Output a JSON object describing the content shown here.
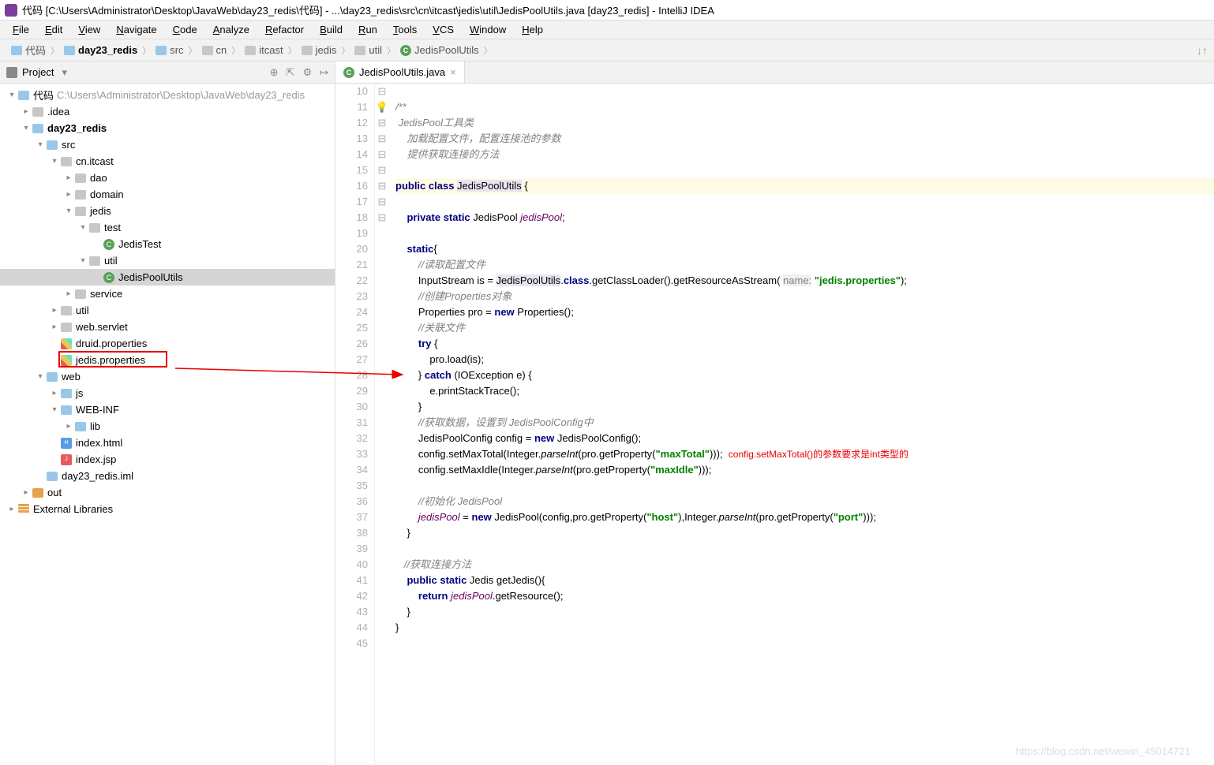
{
  "title": "代码 [C:\\Users\\Administrator\\Desktop\\JavaWeb\\day23_redis\\代码] - ...\\day23_redis\\src\\cn\\itcast\\jedis\\util\\JedisPoolUtils.java [day23_redis] - IntelliJ IDEA",
  "menu": [
    "File",
    "Edit",
    "View",
    "Navigate",
    "Code",
    "Analyze",
    "Refactor",
    "Build",
    "Run",
    "Tools",
    "VCS",
    "Window",
    "Help"
  ],
  "breadcrumbs": [
    {
      "label": "代码",
      "icon": "fld"
    },
    {
      "label": "day23_redis",
      "icon": "fld",
      "bold": true
    },
    {
      "label": "src",
      "icon": "fld"
    },
    {
      "label": "cn",
      "icon": "fld-gray"
    },
    {
      "label": "itcast",
      "icon": "fld-gray"
    },
    {
      "label": "jedis",
      "icon": "fld-gray"
    },
    {
      "label": "util",
      "icon": "fld-gray"
    },
    {
      "label": "JedisPoolUtils",
      "icon": "class"
    }
  ],
  "sidebar": {
    "title": "Project",
    "tree": [
      {
        "d": 0,
        "a": "v",
        "i": "fld",
        "l": "代码",
        "hint": "C:\\Users\\Administrator\\Desktop\\JavaWeb\\day23_redis"
      },
      {
        "d": 1,
        "a": ">",
        "i": "fld-gray",
        "l": ".idea"
      },
      {
        "d": 1,
        "a": "v",
        "i": "fld",
        "l": "day23_redis",
        "bold": true
      },
      {
        "d": 2,
        "a": "v",
        "i": "fld",
        "l": "src"
      },
      {
        "d": 3,
        "a": "v",
        "i": "fld-gray",
        "l": "cn.itcast"
      },
      {
        "d": 4,
        "a": ">",
        "i": "fld-gray",
        "l": "dao"
      },
      {
        "d": 4,
        "a": ">",
        "i": "fld-gray",
        "l": "domain"
      },
      {
        "d": 4,
        "a": "v",
        "i": "fld-gray",
        "l": "jedis"
      },
      {
        "d": 5,
        "a": "v",
        "i": "fld-gray",
        "l": "test"
      },
      {
        "d": 6,
        "a": "",
        "i": "class",
        "l": "JedisTest"
      },
      {
        "d": 5,
        "a": "v",
        "i": "fld-gray",
        "l": "util"
      },
      {
        "d": 6,
        "a": "",
        "i": "class",
        "l": "JedisPoolUtils",
        "sel": true
      },
      {
        "d": 4,
        "a": ">",
        "i": "fld-gray",
        "l": "service"
      },
      {
        "d": 3,
        "a": ">",
        "i": "fld-gray",
        "l": "util"
      },
      {
        "d": 3,
        "a": ">",
        "i": "fld-gray",
        "l": "web.servlet"
      },
      {
        "d": 3,
        "a": "",
        "i": "prop",
        "l": "druid.properties"
      },
      {
        "d": 3,
        "a": "",
        "i": "prop",
        "l": "jedis.properties",
        "boxed": true
      },
      {
        "d": 2,
        "a": "v",
        "i": "fld",
        "l": "web"
      },
      {
        "d": 3,
        "a": ">",
        "i": "fld",
        "l": "js"
      },
      {
        "d": 3,
        "a": "v",
        "i": "fld",
        "l": "WEB-INF"
      },
      {
        "d": 4,
        "a": ">",
        "i": "fld",
        "l": "lib"
      },
      {
        "d": 3,
        "a": "",
        "i": "html",
        "l": "index.html"
      },
      {
        "d": 3,
        "a": "",
        "i": "jsp",
        "l": "index.jsp"
      },
      {
        "d": 2,
        "a": "",
        "i": "fld",
        "l": "day23_redis.iml"
      },
      {
        "d": 1,
        "a": ">",
        "i": "fld-orange",
        "l": "out"
      },
      {
        "d": 0,
        "a": ">",
        "i": "lib",
        "l": "External Libraries"
      }
    ]
  },
  "tab": {
    "label": "JedisPoolUtils.java"
  },
  "code": {
    "start": 10,
    "lines": [
      {
        "t": ""
      },
      {
        "t": "/**",
        "cls": "cmt",
        "fold": "-"
      },
      {
        "t": " JedisPool工具类",
        "cls": "cmt"
      },
      {
        "t": "    加载配置文件，配置连接池的参数",
        "cls": "cmt"
      },
      {
        "t": "    提供获取连接的方法",
        "cls": "cmt"
      },
      {
        "t": "",
        "bulb": true
      },
      {
        "html": "<span class='kw'>public class</span> <span class='cname'>JedisPoolUtils</span> {",
        "hl": true,
        "fold": "-"
      },
      {
        "t": ""
      },
      {
        "html": "    <span class='kw'>private static</span> JedisPool <span class='field'>jedisPool</span>;"
      },
      {
        "t": ""
      },
      {
        "html": "    <span class='kw'>static</span>{",
        "fold": "-"
      },
      {
        "html": "        <span class='cmt'>//读取配置文件</span>"
      },
      {
        "html": "        InputStream is = <span class='cname'>JedisPoolUtils</span>.<span class='kw'>class</span>.getClassLoader().getResourceAsStream( <span class='pname'>name:</span> <span class='str'>\"jedis.properties\"</span>);"
      },
      {
        "html": "        <span class='cmt'>//创建Properties对象</span>"
      },
      {
        "html": "        Properties pro = <span class='kw'>new</span> Properties();"
      },
      {
        "html": "        <span class='cmt'>//关联文件</span>"
      },
      {
        "html": "        <span class='kw'>try</span> {",
        "fold": "-"
      },
      {
        "html": "            pro.load(is);"
      },
      {
        "html": "        } <span class='kw'>catch</span> (IOException e) {",
        "fold": "-"
      },
      {
        "html": "            e.printStackTrace();"
      },
      {
        "html": "        }"
      },
      {
        "html": "        <span class='cmt'>//获取数据，设置到 JedisPoolConfig中</span>"
      },
      {
        "html": "        JedisPoolConfig config = <span class='kw'>new</span> JedisPoolConfig();"
      },
      {
        "html": "        config.setMaxTotal(Integer.<span style='font-style:italic'>parseInt</span>(pro.getProperty(<span class='str'>\"maxTotal\"</span>)));  <span class='ann'>config.setMaxTotal()的参数要求是int类型的</span>"
      },
      {
        "html": "        config.setMaxIdle(Integer.<span style='font-style:italic'>parseInt</span>(pro.getProperty(<span class='str'>\"maxIdle\"</span>)));"
      },
      {
        "t": ""
      },
      {
        "html": "        <span class='cmt'>//初始化 JedisPool</span>"
      },
      {
        "html": "        <span class='field'>jedisPool</span> = <span class='kw'>new</span> JedisPool(config,pro.getProperty(<span class='str'>\"host\"</span>),Integer.<span style='font-style:italic'>parseInt</span>(pro.getProperty(<span class='str'>\"port\"</span>)));"
      },
      {
        "html": "    }",
        "fold": "-"
      },
      {
        "t": ""
      },
      {
        "html": "   <span class='cmt'>//获取连接方法</span>"
      },
      {
        "html": "    <span class='kw'>public static</span> Jedis getJedis(){",
        "fold": "-"
      },
      {
        "html": "        <span class='kw'>return</span> <span class='field'>jedisPool</span>.getResource();"
      },
      {
        "html": "    }",
        "fold": "-"
      },
      {
        "html": "}"
      },
      {
        "t": ""
      }
    ]
  },
  "watermark": "https://blog.csdn.net/weixin_45014721"
}
